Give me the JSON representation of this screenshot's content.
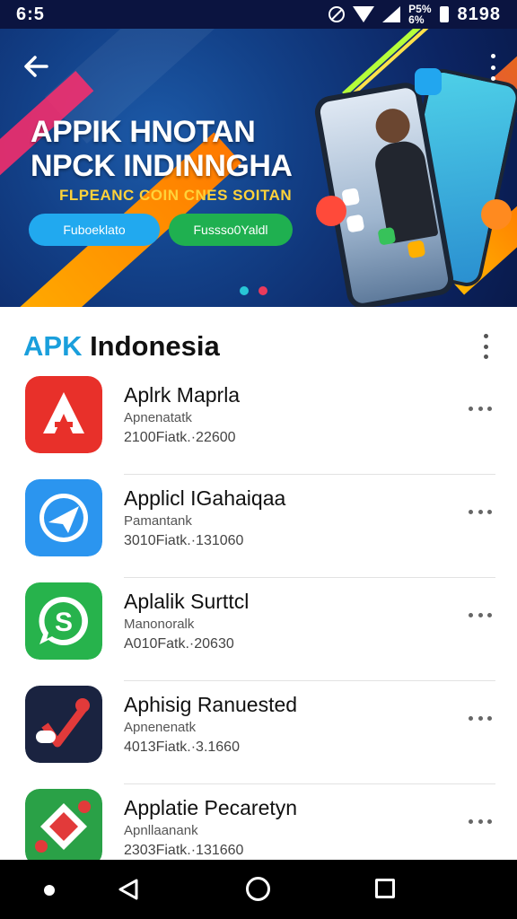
{
  "status_bar": {
    "time_left": "6:5",
    "battery_label_top": "P5%",
    "battery_label_bottom": "6%",
    "clock": "8198",
    "icons": [
      "dnd-icon",
      "wifi-icon",
      "signal-icon",
      "battery-icon"
    ]
  },
  "banner": {
    "title_line1": "APPIK HNOTAN",
    "title_line2": "NPCK INDINNGHA",
    "subtitle": "FLPEANC COIN CNES SOITAN",
    "button_primary": "Fuboeklato",
    "button_secondary": "Fussso0Yaldl",
    "page_count": 2,
    "active_page": 1,
    "colors": {
      "primary_button": "#21a9ef",
      "secondary_button": "#1fb050",
      "subtitle": "#ffd23a"
    }
  },
  "section": {
    "title_accent": "APK",
    "title_rest": " Indonesia"
  },
  "apps": [
    {
      "name": "Aplrk Maprla",
      "developer": "Apnenatatk",
      "meta": "2100Fiatk.·22600",
      "icon": "red-a-logo-icon",
      "color": "#e8302a"
    },
    {
      "name": "Applicl IGahaiqaa",
      "developer": "Pamantank",
      "meta": "3010Fiatk.·131060",
      "icon": "paper-plane-icon",
      "color": "#2b95ef"
    },
    {
      "name": "Aplalik Surttcl",
      "developer": "Manonoralk",
      "meta": "A010Fatk.·20630",
      "icon": "chat-bubble-s-icon",
      "color": "#27b34c"
    },
    {
      "name": "Aphisig Ranuested",
      "developer": "Apnenenatk",
      "meta": "4013Fiatk.·3.1660",
      "icon": "checkmark-logo-icon",
      "color": "#1a2340"
    },
    {
      "name": "Applatie Pecaretyn",
      "developer": "Apnllaanank",
      "meta": "2303Fiatk.·131660",
      "icon": "red-diamond-logo-icon",
      "color": "#2aa147"
    }
  ],
  "nav": {
    "buttons": [
      "nav-dot-icon",
      "back-triangle-icon",
      "home-circle-icon",
      "recent-square-icon"
    ]
  }
}
